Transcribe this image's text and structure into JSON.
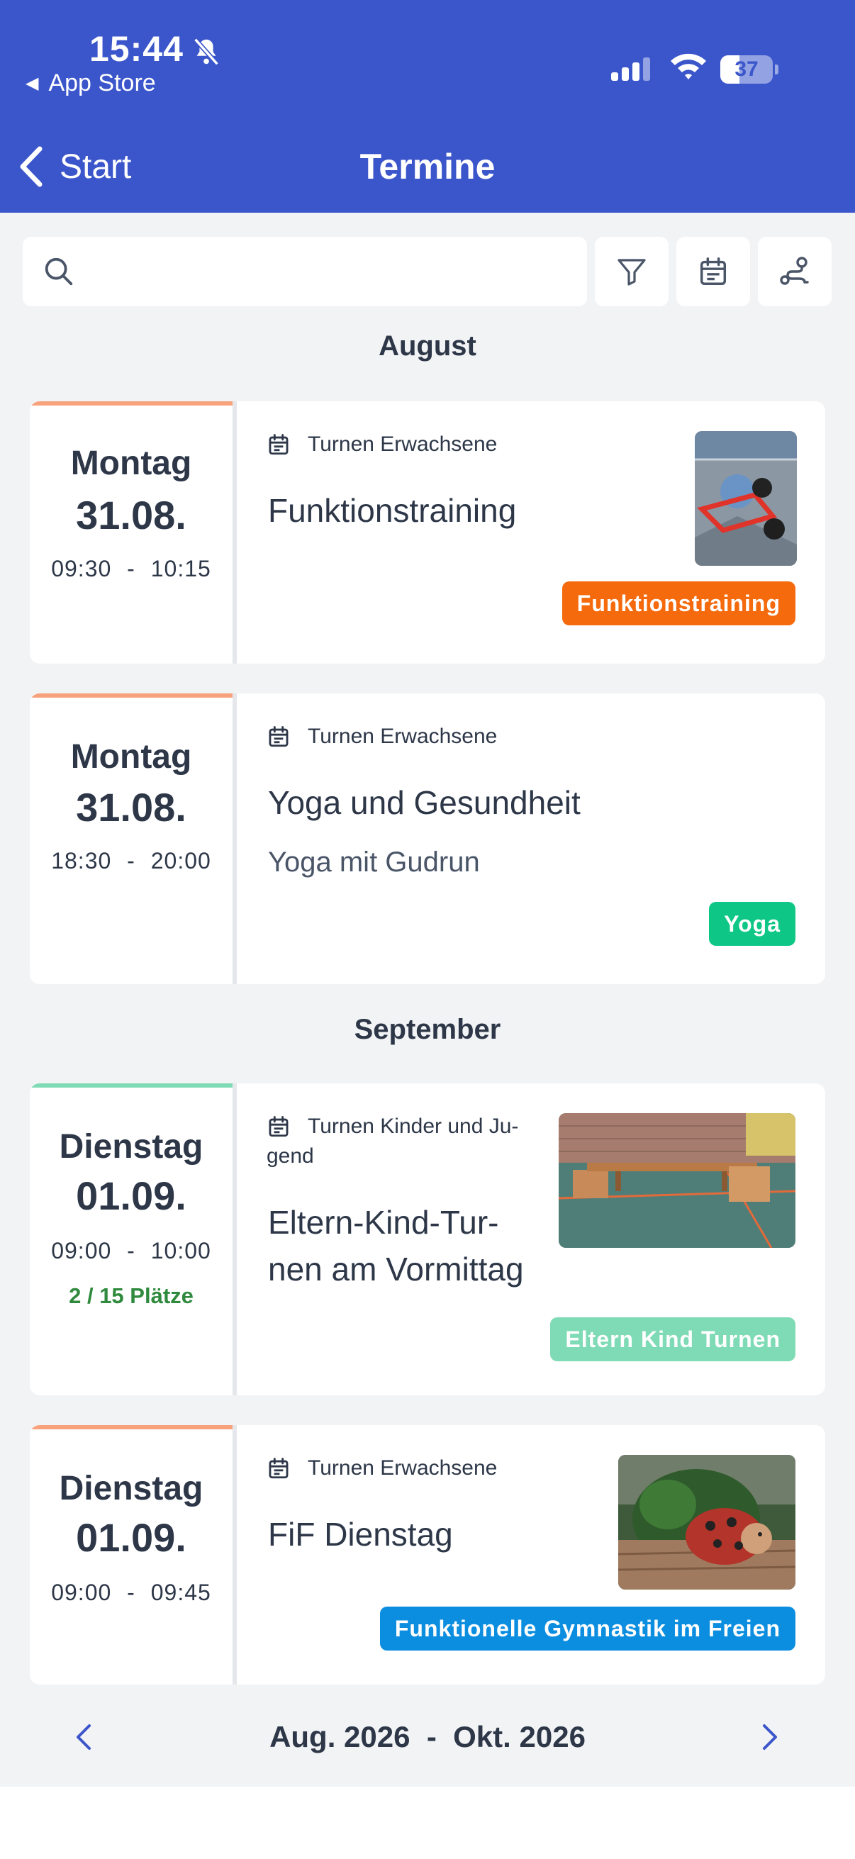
{
  "status": {
    "time": "15:44",
    "back_app": "App Store",
    "battery": "37",
    "battery_level": 0.37
  },
  "nav": {
    "back_label": "Start",
    "title": "Termine"
  },
  "search": {
    "placeholder": "",
    "value": ""
  },
  "tools": [
    "filter-icon",
    "calendar-icon",
    "route-icon"
  ],
  "groups": [
    {
      "month": "August",
      "events": [
        {
          "weekday": "Montag",
          "date": "31.08.",
          "start": "09:30",
          "end": "10:15",
          "category": "Turnen Erwachsene",
          "title": "Funktionstraining",
          "subtitle": "",
          "tag": "Funktionstraining",
          "tag_color": "#f46a0c",
          "bar_color": "#f8a27d",
          "places": ""
        },
        {
          "weekday": "Montag",
          "date": "31.08.",
          "start": "18:30",
          "end": "20:00",
          "category": "Turnen Erwachsene",
          "title": "Yoga und Gesundheit",
          "subtitle": "Yoga mit Gudrun",
          "tag": "Yoga",
          "tag_color": "#0ec786",
          "bar_color": "#f8a27d",
          "places": ""
        }
      ]
    },
    {
      "month": "September",
      "events": [
        {
          "weekday": "Dienstag",
          "date": "01.09.",
          "start": "09:00",
          "end": "10:00",
          "category_line1": "Turnen Kinder und Ju-",
          "category_line2": "gend",
          "title_line1": "Eltern-Kind-Tur-",
          "title_line2": "nen am Vormittag",
          "subtitle": "",
          "tag": "Eltern Kind Turnen",
          "tag_color": "#7fdbb5",
          "bar_color": "#7fdbb5",
          "places": "2 / 15 Plätze"
        },
        {
          "weekday": "Dienstag",
          "date": "01.09.",
          "start": "09:00",
          "end": "09:45",
          "category": "Turnen Erwachsene",
          "title": "FiF Dienstag",
          "subtitle": "",
          "tag": "Funktionelle Gymnastik im Freien",
          "tag_color": "#0c8ee0",
          "bar_color": "#f8a27d",
          "places": ""
        }
      ]
    }
  ],
  "pager": {
    "label": "Aug. 2026  -  Okt. 2026"
  },
  "sep": "-"
}
